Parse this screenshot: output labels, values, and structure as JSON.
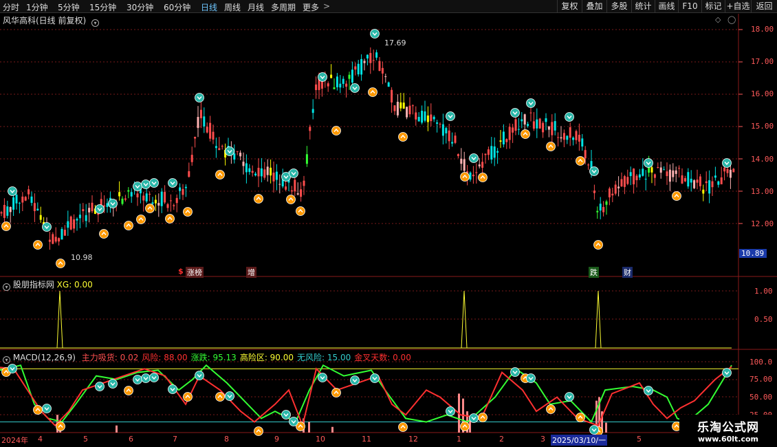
{
  "toolbar": {
    "periods": [
      "分时",
      "1分钟",
      "5分钟",
      "15分钟",
      "30分钟",
      "60分钟",
      "日线",
      "周线",
      "月线",
      "多周期",
      "更多"
    ],
    "active_period": "日线",
    "right_buttons": [
      "复权",
      "叠加",
      "多股",
      "统计",
      "画线",
      "F10",
      "标记",
      "+自选",
      "返回"
    ]
  },
  "main_panel": {
    "title": "风华高科(日线 前复权)",
    "high_label": "17.69",
    "low_label": "10.98",
    "current_price": "10.89",
    "y_ticks": [
      "18.00",
      "17.00",
      "16.00",
      "15.00",
      "14.00",
      "13.00",
      "12.00"
    ],
    "markers": [
      "$",
      "涨榜",
      "增",
      "跌",
      "财"
    ]
  },
  "ind_panel": {
    "title": "股朋指标网",
    "xg_label": "XG: 0.00",
    "y_ticks": [
      "1.00",
      "0.50"
    ]
  },
  "macd_panel": {
    "title": "MACD(12,26,9)",
    "items": [
      {
        "label": "主力吸货: 0.02",
        "color": "#ff5050"
      },
      {
        "label": "风险: 88.00",
        "color": "#ff3030"
      },
      {
        "label": "涨跌: 95.13",
        "color": "#33ff33"
      },
      {
        "label": "高险区: 90.00",
        "color": "#ffff33"
      },
      {
        "label": "无风险: 15.00",
        "color": "#33cccc"
      },
      {
        "label": "金叉天数: 0.00",
        "color": "#ff3030"
      }
    ],
    "y_ticks": [
      "100.0",
      "75.00",
      "50.00",
      "25.00"
    ]
  },
  "time_axis": {
    "months": [
      "2024年",
      "4",
      "5",
      "6",
      "7",
      "8",
      "9",
      "10",
      "11",
      "12",
      "1",
      "2",
      "3",
      "2025/03/10/一",
      "5"
    ]
  },
  "watermark": {
    "line1": "乐淘公式网",
    "line2": "www.60lt.com"
  },
  "colors": {
    "up": "#ff4d4d",
    "down": "#00e5e5",
    "background": "#000000",
    "grid": "#7a1a1a",
    "axis_text": "#ff5a5a",
    "signal_line": "#ffff33"
  }
}
